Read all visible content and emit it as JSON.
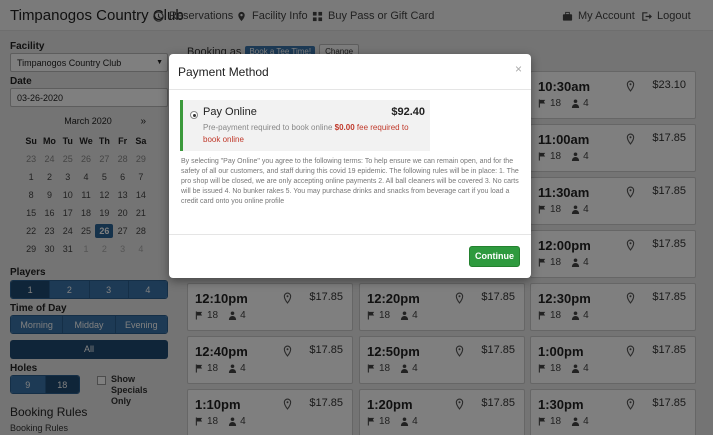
{
  "nav": {
    "brand": "Timpanogos Country Club",
    "reservations": "Reservations",
    "facility_info": "Facility Info",
    "buy_pass": "Buy Pass or Gift Card",
    "my_account": "My Account",
    "logout": "Logout"
  },
  "sidebar": {
    "facility_label": "Facility",
    "facility_value": "Timpanogos Country Club",
    "date_label": "Date",
    "date_value": "03-26-2020",
    "calendar": {
      "month": "March 2020",
      "next": "»",
      "dow": [
        "Su",
        "Mo",
        "Tu",
        "We",
        "Th",
        "Fr",
        "Sa"
      ],
      "weeks": [
        [
          "23",
          "24",
          "25",
          "26",
          "27",
          "28",
          "29"
        ],
        [
          "1",
          "2",
          "3",
          "4",
          "5",
          "6",
          "7"
        ],
        [
          "8",
          "9",
          "10",
          "11",
          "12",
          "13",
          "14"
        ],
        [
          "15",
          "16",
          "17",
          "18",
          "19",
          "20",
          "21"
        ],
        [
          "22",
          "23",
          "24",
          "25",
          "26",
          "27",
          "28"
        ],
        [
          "29",
          "30",
          "31",
          "1",
          "2",
          "3",
          "4"
        ]
      ],
      "selected": "26"
    },
    "players_label": "Players",
    "players": [
      "1",
      "2",
      "3",
      "4"
    ],
    "players_selected": "1",
    "tod_label": "Time of Day",
    "tod": [
      "Morning",
      "Midday",
      "Evening"
    ],
    "all": "All",
    "holes_label": "Holes",
    "holes": [
      "9",
      "18"
    ],
    "holes_selected": "18",
    "show_specials": "Show Specials Only",
    "booking_rules_heading": "Booking Rules",
    "booking_rules_sub": "Booking Rules"
  },
  "booking": {
    "booking_as": "Booking as",
    "badge": "Book a Tee Time!",
    "change": "Change"
  },
  "tee_times": [
    {
      "time": "10:30am",
      "price": "$23.10",
      "holes": "18",
      "players": "4"
    },
    {
      "time": "11:00am",
      "price": "$17.85",
      "holes": "18",
      "players": "4"
    },
    {
      "time": "11:30am",
      "price": "$17.85",
      "holes": "18",
      "players": "4"
    },
    {
      "time": "12:00pm",
      "price": "$17.85",
      "holes": "18",
      "players": "4"
    },
    {
      "time": "12:10pm",
      "price": "$17.85",
      "holes": "18",
      "players": "4"
    },
    {
      "time": "12:20pm",
      "price": "$17.85",
      "holes": "18",
      "players": "4"
    },
    {
      "time": "12:30pm",
      "price": "$17.85",
      "holes": "18",
      "players": "4"
    },
    {
      "time": "12:40pm",
      "price": "$17.85",
      "holes": "18",
      "players": "4"
    },
    {
      "time": "12:50pm",
      "price": "$17.85",
      "holes": "18",
      "players": "4"
    },
    {
      "time": "1:00pm",
      "price": "$17.85",
      "holes": "18",
      "players": "4"
    },
    {
      "time": "1:10pm",
      "price": "$17.85",
      "holes": "18",
      "players": "4"
    },
    {
      "time": "1:20pm",
      "price": "$17.85",
      "holes": "18",
      "players": "4"
    },
    {
      "time": "1:30pm",
      "price": "$17.85",
      "holes": "18",
      "players": "4"
    }
  ],
  "modal": {
    "title": "Payment Method",
    "close": "×",
    "option_name": "Pay Online",
    "option_amount": "$92.40",
    "desc_prefix": "Pre-payment required to book online",
    "desc_fee": "$0.00",
    "desc_suffix": "fee required to book online",
    "terms": "By selecting \"Pay Online\" you agree to the following terms: To help ensure we can remain open, and for the safety of all our customers, and staff during this covid 19 epidemic. The following rules will be in place: 1. The pro shop will be closed, we are only accepting online payments 2. All ball cleaners will be covered 3. No carts will be issued 4. No bunker rakes 5. You may purchase drinks and snacks from beverage cart if you load a credit card onto you online profile",
    "continue": "Continue"
  },
  "icons": {
    "reservations": "clock-icon",
    "facility": "map-pin-icon",
    "buy": "grid-icon",
    "account": "briefcase-icon",
    "logout": "logout-icon",
    "flag": "flag-icon",
    "person": "person-icon"
  },
  "colors": {
    "primary": "#3a75ab",
    "primary_dark": "#1f4a72",
    "success": "#2e9a3e",
    "fee": "#c0392b"
  }
}
